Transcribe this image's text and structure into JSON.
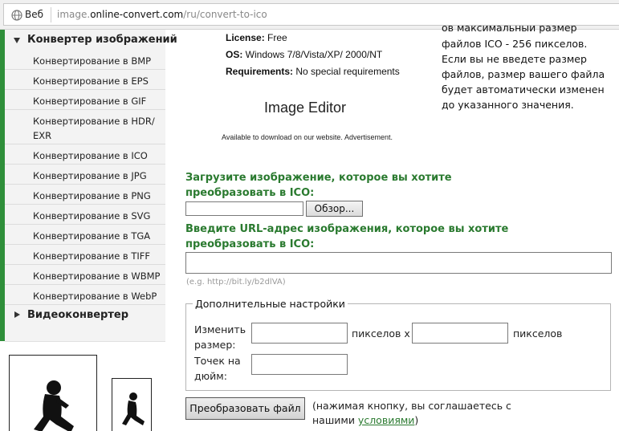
{
  "browser": {
    "label": "Веб",
    "url_prefix": "image.",
    "url_domain": "online-convert.com",
    "url_path": "/ru/convert-to-ico"
  },
  "sidebar": {
    "category_images": "Конвертер изображений",
    "items": [
      {
        "label": "Конвертирование в BMP"
      },
      {
        "label": "Конвертирование в EPS"
      },
      {
        "label": "Конвертирование в GIF"
      },
      {
        "label": "Конвертирование в HDR/"
      },
      {
        "label": "Конвертирование в ICO"
      },
      {
        "label": "Конвертирование в JPG"
      },
      {
        "label": "Конвертирование в PNG"
      },
      {
        "label": "Конвертирование в SVG"
      },
      {
        "label": "Конвертирование в TGA"
      },
      {
        "label": "Конвертирование в TIFF"
      },
      {
        "label": "Конвертирование в WBMP"
      },
      {
        "label": "Конвертирование в WebP"
      }
    ],
    "hdr_second_line": "EXR",
    "category_video": "Видеоконвертер"
  },
  "ad": {
    "license_label": "License:",
    "license_value": " Free",
    "os_label": "OS:",
    "os_value": " Windows 7/8/Vista/XP/ 2000/NT",
    "req_label": "Requirements:",
    "req_value": " No special requirements",
    "product": "Image Editor",
    "note": "Available to download on our website. Advertisement."
  },
  "notice": {
    "lines": [
      "файлов ICO - 256 пикселов.",
      "Если вы не введете размер",
      "файлов, размер вашего файла",
      "будет автоматически изменен",
      "до указанного значения."
    ]
  },
  "upload": {
    "heading_line1": "Загрузите изображение, которое вы хотите",
    "heading_line2": "преобразовать в ICO:",
    "browse_label": "Обзор..."
  },
  "url_section": {
    "heading_line1": "Введите URL-адрес изображения, которое вы хотите",
    "heading_line2": "преобразовать в ICO:",
    "example": "(e.g. http://bit.ly/b2dlVA)"
  },
  "settings": {
    "legend": "Дополнительные настройки",
    "resize_line1": "Изменить",
    "resize_line2": "размер:",
    "pixels_x": "пикселов x",
    "pixels": "пикселов",
    "dpi_line1": "Точек на",
    "dpi_line2": "дюйм:"
  },
  "convert": {
    "button_label": "Преобразовать файл",
    "agree_line1": "(нажимая кнопку, вы соглашаетесь с",
    "agree_prefix": "нашими ",
    "agree_link": "условиями",
    "agree_suffix": ")"
  }
}
